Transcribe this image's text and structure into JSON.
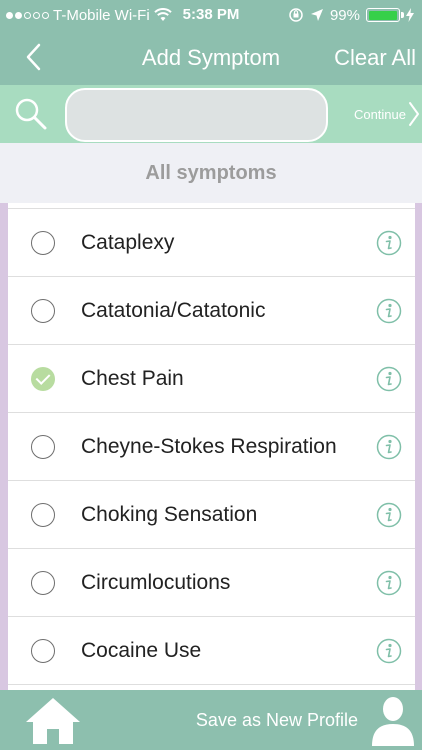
{
  "status": {
    "carrier": "T-Mobile Wi-Fi",
    "time": "5:38 PM",
    "battery": "99%",
    "signal_filled": 2,
    "signal_total": 5
  },
  "nav": {
    "title": "Add Symptom",
    "clear_all": "Clear All"
  },
  "search": {
    "value": "",
    "placeholder": "",
    "continue_label": "Continue"
  },
  "section": {
    "header": "All symptoms"
  },
  "symptoms": [
    {
      "label": "Cataplexy",
      "checked": false
    },
    {
      "label": "Catatonia/Catatonic",
      "checked": false
    },
    {
      "label": "Chest Pain",
      "checked": true
    },
    {
      "label": "Cheyne-Stokes Respiration",
      "checked": false
    },
    {
      "label": "Choking Sensation",
      "checked": false
    },
    {
      "label": "Circumlocutions",
      "checked": false
    },
    {
      "label": "Cocaine Use",
      "checked": false
    }
  ],
  "footer": {
    "save_label": "Save as New Profile"
  },
  "colors": {
    "bar": "#8dbfae",
    "search_bar": "#a8dcc0",
    "accent_info": "#7fbfa8",
    "checked": "#b8dca0",
    "list_border": "#d8c7e1",
    "battery": "#36d04a"
  },
  "icons": {
    "back": "chevron-left-icon",
    "search": "search-icon",
    "continue": "chevron-right-icon",
    "info": "info-icon",
    "home": "home-icon",
    "profile": "user-profile-icon"
  }
}
